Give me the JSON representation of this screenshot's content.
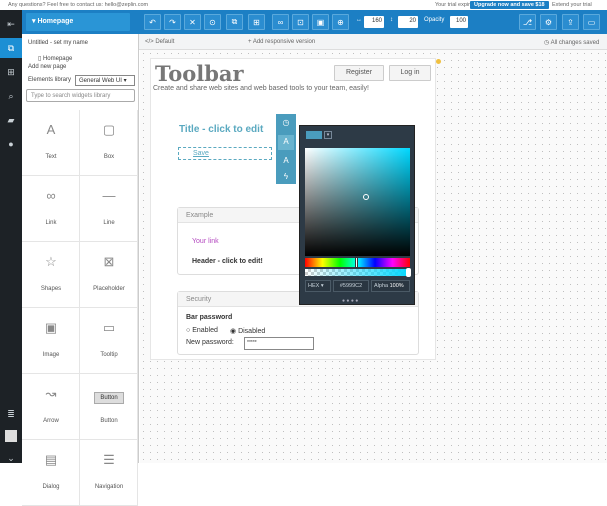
{
  "topbar": {
    "question": "Any questions? Feel free to contact us: hello@zeplin.com",
    "trial": "Your trial expires in 2 days",
    "upgrade": "Upgrade now and save $18",
    "extend": "Extend your trial"
  },
  "toolbar": {
    "page_name": "Homepage",
    "x_value": "160",
    "y_value": "20",
    "opacity_label": "Opacity",
    "opacity_value": "100"
  },
  "subbar": {
    "breadcrumb": "Default",
    "add_version": "Add responsive version",
    "status": "All changes saved"
  },
  "panel": {
    "project_name": "Untitled - set my name",
    "page_item": "Homepage",
    "add_page": "Add new page",
    "library_label": "Elements library",
    "library_value": "General Web UI",
    "search_placeholder": "Type to search widgets library",
    "widgets": [
      {
        "label": "Text",
        "icon": "A"
      },
      {
        "label": "Box",
        "icon": "▢"
      },
      {
        "label": "Link",
        "icon": "∞"
      },
      {
        "label": "Line",
        "icon": "—"
      },
      {
        "label": "Shapes",
        "icon": "☆"
      },
      {
        "label": "Placeholder",
        "icon": "⊠"
      },
      {
        "label": "Image",
        "icon": "▣"
      },
      {
        "label": "Tooltip",
        "icon": "▭"
      },
      {
        "label": "Arrow",
        "icon": "↝"
      },
      {
        "label": "Button",
        "icon": "Button"
      },
      {
        "label": "Dialog",
        "icon": "▤"
      },
      {
        "label": "Navigation",
        "icon": "☰"
      }
    ]
  },
  "site": {
    "logo": "Toolbar",
    "tagline": "Create and share web sites and web based tools to your team, easily!",
    "register": "Register",
    "login": "Log in",
    "title": "Title - click to edit",
    "save_link": "Save",
    "example_head": "Example",
    "your_link": "Your link",
    "header_text": "Header - click to edit!",
    "security_head": "Security",
    "bar_password": "Bar password",
    "enabled": "Enabled",
    "disabled": "Disabled",
    "new_password": "New password:",
    "password_value": "*****"
  },
  "picker": {
    "format": "HEX",
    "hex": "#5999C2",
    "alpha_label": "Alpha",
    "alpha_value": "100%"
  },
  "colors": {
    "toolbar_blue": "#1c7fc4",
    "title_teal": "#5aa9c0",
    "picker_bg": "#2d3a46",
    "swatch": "#4a9cbd"
  }
}
